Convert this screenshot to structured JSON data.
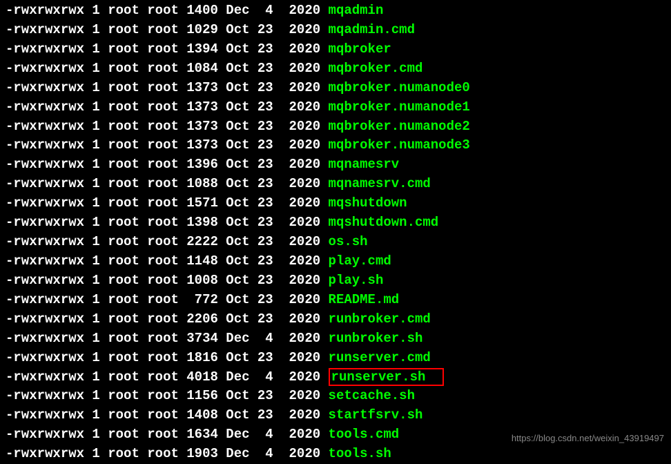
{
  "files": [
    {
      "perm": "-rwxrwxrwx",
      "links": "1",
      "owner": "root",
      "group": "root",
      "size": "1400",
      "month": "Dec",
      "day": " 4",
      "year": "2020",
      "name": "mqadmin",
      "highlighted": false
    },
    {
      "perm": "-rwxrwxrwx",
      "links": "1",
      "owner": "root",
      "group": "root",
      "size": "1029",
      "month": "Oct",
      "day": "23",
      "year": "2020",
      "name": "mqadmin.cmd",
      "highlighted": false
    },
    {
      "perm": "-rwxrwxrwx",
      "links": "1",
      "owner": "root",
      "group": "root",
      "size": "1394",
      "month": "Oct",
      "day": "23",
      "year": "2020",
      "name": "mqbroker",
      "highlighted": false
    },
    {
      "perm": "-rwxrwxrwx",
      "links": "1",
      "owner": "root",
      "group": "root",
      "size": "1084",
      "month": "Oct",
      "day": "23",
      "year": "2020",
      "name": "mqbroker.cmd",
      "highlighted": false
    },
    {
      "perm": "-rwxrwxrwx",
      "links": "1",
      "owner": "root",
      "group": "root",
      "size": "1373",
      "month": "Oct",
      "day": "23",
      "year": "2020",
      "name": "mqbroker.numanode0",
      "highlighted": false
    },
    {
      "perm": "-rwxrwxrwx",
      "links": "1",
      "owner": "root",
      "group": "root",
      "size": "1373",
      "month": "Oct",
      "day": "23",
      "year": "2020",
      "name": "mqbroker.numanode1",
      "highlighted": false
    },
    {
      "perm": "-rwxrwxrwx",
      "links": "1",
      "owner": "root",
      "group": "root",
      "size": "1373",
      "month": "Oct",
      "day": "23",
      "year": "2020",
      "name": "mqbroker.numanode2",
      "highlighted": false
    },
    {
      "perm": "-rwxrwxrwx",
      "links": "1",
      "owner": "root",
      "group": "root",
      "size": "1373",
      "month": "Oct",
      "day": "23",
      "year": "2020",
      "name": "mqbroker.numanode3",
      "highlighted": false
    },
    {
      "perm": "-rwxrwxrwx",
      "links": "1",
      "owner": "root",
      "group": "root",
      "size": "1396",
      "month": "Oct",
      "day": "23",
      "year": "2020",
      "name": "mqnamesrv",
      "highlighted": false
    },
    {
      "perm": "-rwxrwxrwx",
      "links": "1",
      "owner": "root",
      "group": "root",
      "size": "1088",
      "month": "Oct",
      "day": "23",
      "year": "2020",
      "name": "mqnamesrv.cmd",
      "highlighted": false
    },
    {
      "perm": "-rwxrwxrwx",
      "links": "1",
      "owner": "root",
      "group": "root",
      "size": "1571",
      "month": "Oct",
      "day": "23",
      "year": "2020",
      "name": "mqshutdown",
      "highlighted": false
    },
    {
      "perm": "-rwxrwxrwx",
      "links": "1",
      "owner": "root",
      "group": "root",
      "size": "1398",
      "month": "Oct",
      "day": "23",
      "year": "2020",
      "name": "mqshutdown.cmd",
      "highlighted": false
    },
    {
      "perm": "-rwxrwxrwx",
      "links": "1",
      "owner": "root",
      "group": "root",
      "size": "2222",
      "month": "Oct",
      "day": "23",
      "year": "2020",
      "name": "os.sh",
      "highlighted": false
    },
    {
      "perm": "-rwxrwxrwx",
      "links": "1",
      "owner": "root",
      "group": "root",
      "size": "1148",
      "month": "Oct",
      "day": "23",
      "year": "2020",
      "name": "play.cmd",
      "highlighted": false
    },
    {
      "perm": "-rwxrwxrwx",
      "links": "1",
      "owner": "root",
      "group": "root",
      "size": "1008",
      "month": "Oct",
      "day": "23",
      "year": "2020",
      "name": "play.sh",
      "highlighted": false
    },
    {
      "perm": "-rwxrwxrwx",
      "links": "1",
      "owner": "root",
      "group": "root",
      "size": " 772",
      "month": "Oct",
      "day": "23",
      "year": "2020",
      "name": "README.md",
      "highlighted": false
    },
    {
      "perm": "-rwxrwxrwx",
      "links": "1",
      "owner": "root",
      "group": "root",
      "size": "2206",
      "month": "Oct",
      "day": "23",
      "year": "2020",
      "name": "runbroker.cmd",
      "highlighted": false
    },
    {
      "perm": "-rwxrwxrwx",
      "links": "1",
      "owner": "root",
      "group": "root",
      "size": "3734",
      "month": "Dec",
      "day": " 4",
      "year": "2020",
      "name": "runbroker.sh",
      "highlighted": false
    },
    {
      "perm": "-rwxrwxrwx",
      "links": "1",
      "owner": "root",
      "group": "root",
      "size": "1816",
      "month": "Oct",
      "day": "23",
      "year": "2020",
      "name": "runserver.cmd",
      "highlighted": false
    },
    {
      "perm": "-rwxrwxrwx",
      "links": "1",
      "owner": "root",
      "group": "root",
      "size": "4018",
      "month": "Dec",
      "day": " 4",
      "year": "2020",
      "name": "runserver.sh",
      "highlighted": true
    },
    {
      "perm": "-rwxrwxrwx",
      "links": "1",
      "owner": "root",
      "group": "root",
      "size": "1156",
      "month": "Oct",
      "day": "23",
      "year": "2020",
      "name": "setcache.sh",
      "highlighted": false
    },
    {
      "perm": "-rwxrwxrwx",
      "links": "1",
      "owner": "root",
      "group": "root",
      "size": "1408",
      "month": "Oct",
      "day": "23",
      "year": "2020",
      "name": "startfsrv.sh",
      "highlighted": false
    },
    {
      "perm": "-rwxrwxrwx",
      "links": "1",
      "owner": "root",
      "group": "root",
      "size": "1634",
      "month": "Dec",
      "day": " 4",
      "year": "2020",
      "name": "tools.cmd",
      "highlighted": false
    },
    {
      "perm": "-rwxrwxrwx",
      "links": "1",
      "owner": "root",
      "group": "root",
      "size": "1903",
      "month": "Dec",
      "day": " 4",
      "year": "2020",
      "name": "tools.sh",
      "highlighted": false
    }
  ],
  "watermark": "https://blog.csdn.net/weixin_43919497"
}
